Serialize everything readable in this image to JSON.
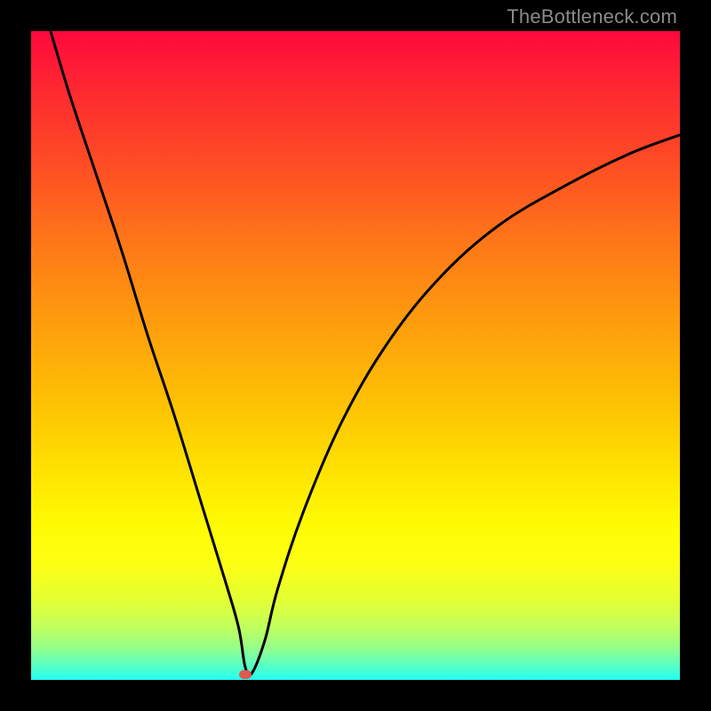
{
  "attribution": "TheBottleneck.com",
  "colors": {
    "curve_stroke": "#000000",
    "marker_fill": "#e0594f",
    "frame_bg": "#000000"
  },
  "chart_data": {
    "type": "line",
    "title": "",
    "xlabel": "",
    "ylabel": "",
    "xlim": [
      0,
      100
    ],
    "ylim": [
      0,
      100
    ],
    "annotations": [],
    "series": [
      {
        "name": "bottleneck-curve",
        "x": [
          3,
          6,
          10,
          14,
          18,
          22,
          26,
          30,
          32,
          33,
          34,
          36,
          38,
          42,
          48,
          55,
          63,
          72,
          82,
          92,
          100
        ],
        "y": [
          100,
          90,
          78,
          66,
          53,
          41,
          28,
          15,
          8,
          2,
          1,
          6,
          14,
          26,
          40,
          52,
          62,
          70,
          76,
          81,
          84
        ]
      }
    ],
    "marker": {
      "x": 33,
      "y": 0.8
    }
  }
}
